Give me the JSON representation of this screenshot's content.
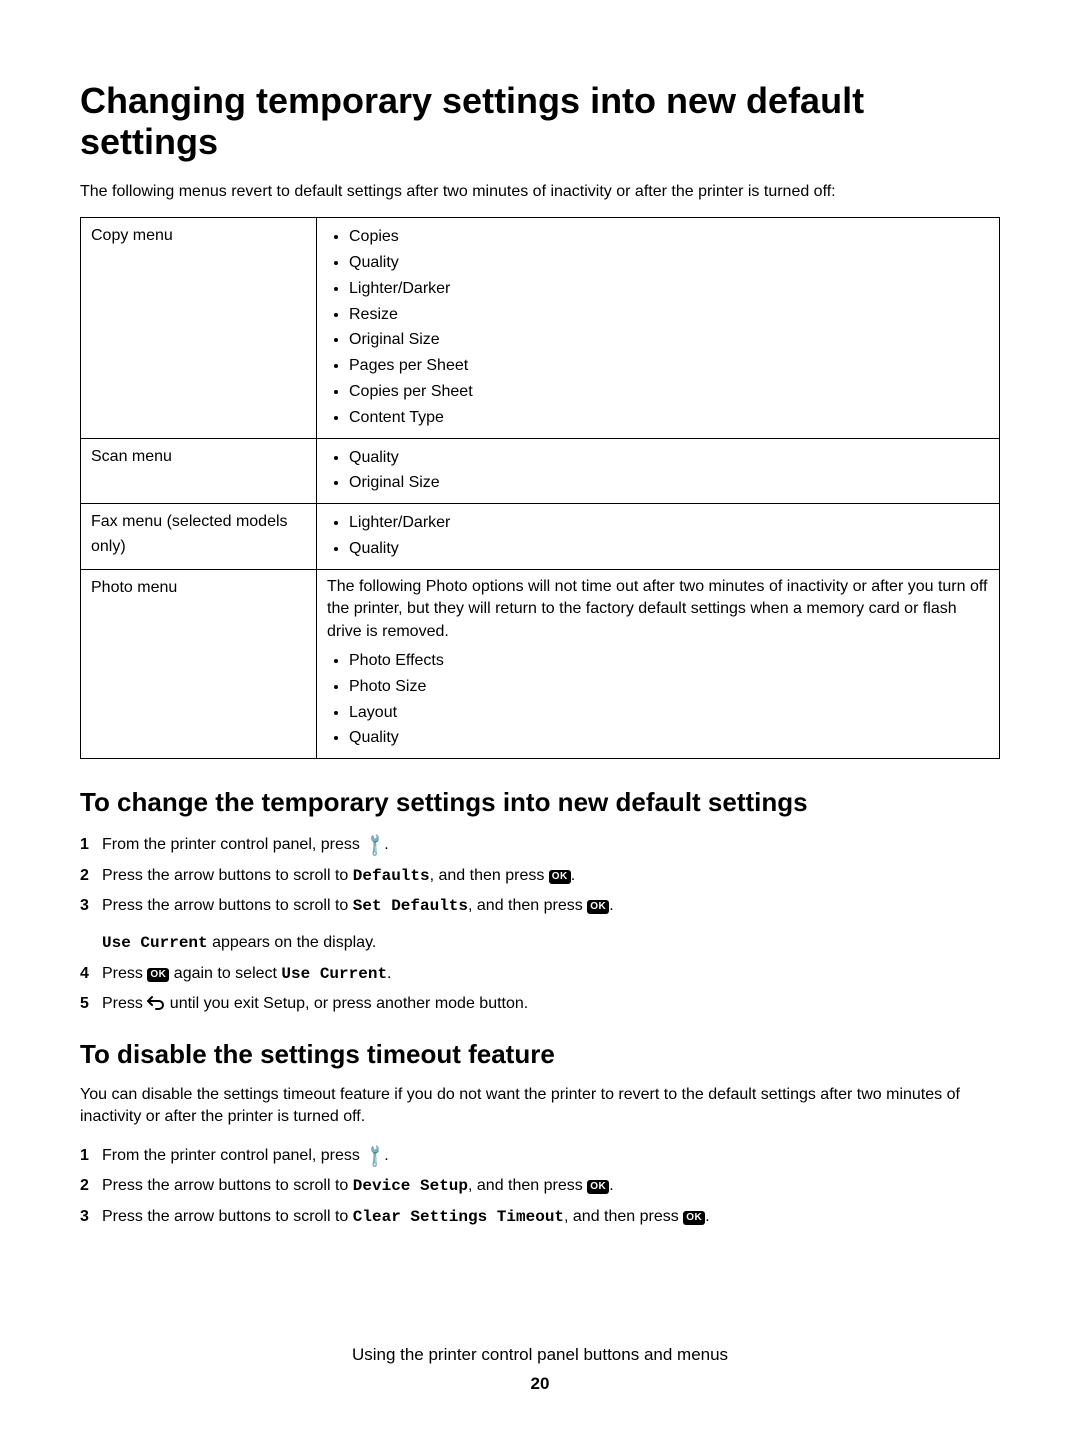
{
  "heading_main": "Changing temporary settings into new default settings",
  "intro_text": "The following menus revert to default settings after two minutes of inactivity or after the printer is turned off:",
  "table": {
    "rows": [
      {
        "left": "Copy menu",
        "type": "list",
        "items": [
          "Copies",
          "Quality",
          "Lighter/Darker",
          "Resize",
          "Original Size",
          "Pages per Sheet",
          "Copies per Sheet",
          "Content Type"
        ]
      },
      {
        "left": "Scan menu",
        "type": "list",
        "items": [
          "Quality",
          "Original Size"
        ]
      },
      {
        "left": "Fax menu (selected models only)",
        "type": "list",
        "items": [
          "Lighter/Darker",
          "Quality"
        ]
      },
      {
        "left": "Photo menu",
        "type": "photo",
        "note": "The following Photo options will not time out after two minutes of inactivity or after you turn off the printer, but they will return to the factory default settings when a memory card or flash drive is removed.",
        "items": [
          "Photo Effects",
          "Photo Size",
          "Layout",
          "Quality"
        ]
      }
    ]
  },
  "heading_change": "To change the temporary settings into new default settings",
  "steps_change": {
    "s1a": "From the printer control panel, press ",
    "s1b": ".",
    "s2a": "Press the arrow buttons to scroll to ",
    "s2b": "Defaults",
    "s2c": ", and then press ",
    "s2d": ".",
    "s3a": "Press the arrow buttons to scroll to ",
    "s3b": "Set Defaults",
    "s3c": ", and then press ",
    "s3d": ".",
    "s3sub_a": "Use Current",
    "s3sub_b": " appears on the display.",
    "s4a": "Press ",
    "s4b": " again to select ",
    "s4c": "Use Current",
    "s4d": ".",
    "s5a": "Press ",
    "s5b": " until you exit Setup, or press another mode button."
  },
  "heading_disable": "To disable the settings timeout feature",
  "disable_intro": "You can disable the settings timeout feature if you do not want the printer to revert to the default settings after two minutes of inactivity or after the printer is turned off.",
  "steps_disable": {
    "s1a": "From the printer control panel, press ",
    "s1b": ".",
    "s2a": "Press the arrow buttons to scroll to ",
    "s2b": "Device Setup",
    "s2c": ", and then press ",
    "s2d": ".",
    "s3a": "Press the arrow buttons to scroll to ",
    "s3b": "Clear Settings Timeout",
    "s3c": ", and then press ",
    "s3d": "."
  },
  "footer_title": "Using the printer control panel buttons and menus",
  "footer_page": "20",
  "icons": {
    "ok_label": "OK"
  },
  "nums": {
    "n1": "1",
    "n2": "2",
    "n3": "3",
    "n4": "4",
    "n5": "5"
  }
}
